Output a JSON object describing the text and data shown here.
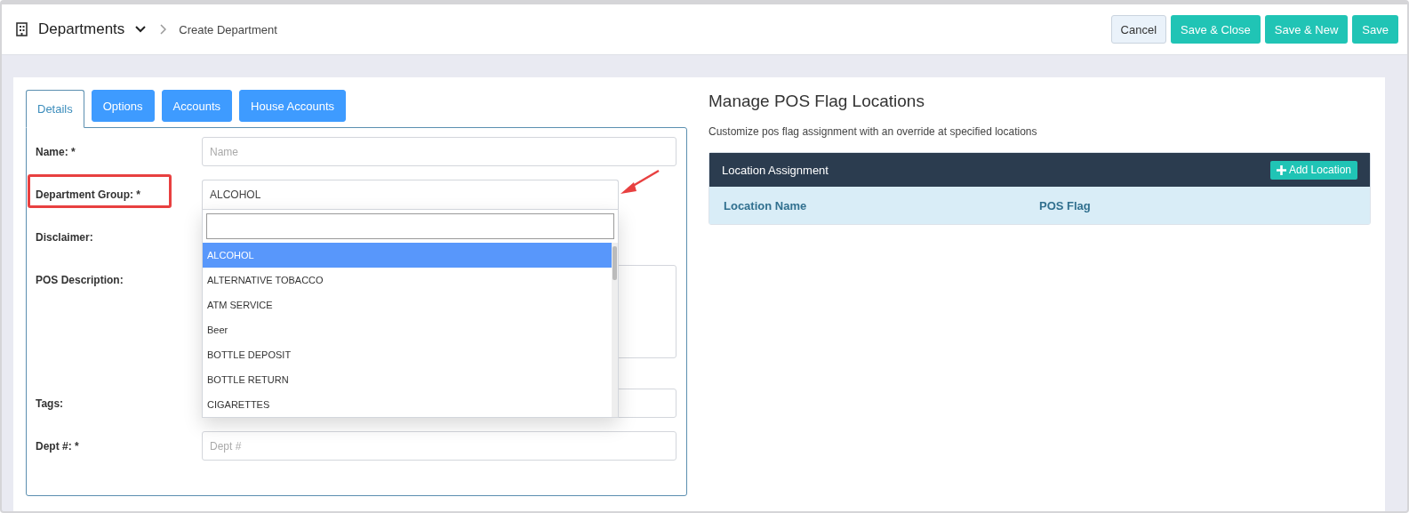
{
  "header": {
    "title": "Departments",
    "breadcrumb": "Create Department",
    "buttons": [
      {
        "label": "Cancel",
        "kind": "secondary"
      },
      {
        "label": "Save & Close",
        "kind": "primary"
      },
      {
        "label": "Save & New",
        "kind": "primary"
      },
      {
        "label": "Save",
        "kind": "primary"
      }
    ]
  },
  "tabs": [
    {
      "label": "Details",
      "selected": true
    },
    {
      "label": "Options",
      "selected": false
    },
    {
      "label": "Accounts",
      "selected": false
    },
    {
      "label": "House Accounts",
      "selected": false
    }
  ],
  "form": {
    "fields": [
      {
        "label": "Name: *",
        "kind": "input",
        "placeholder": "Name"
      },
      {
        "label": "Department Group: *",
        "kind": "select",
        "value": "ALCOHOL",
        "highlighted": true,
        "expanded": true
      },
      {
        "label": "Disclaimer:",
        "kind": "hidden"
      },
      {
        "label": "POS Description:",
        "kind": "textarea"
      },
      {
        "label": "Tags:",
        "kind": "input"
      },
      {
        "label": "Dept #: *",
        "kind": "input",
        "placeholder": "Dept #"
      }
    ]
  },
  "dropdown": {
    "options": [
      {
        "label": "ALCOHOL",
        "selected": true
      },
      {
        "label": "ALTERNATIVE TOBACCO",
        "selected": false
      },
      {
        "label": "ATM SERVICE",
        "selected": false
      },
      {
        "label": "Beer",
        "selected": false
      },
      {
        "label": "BOTTLE DEPOSIT",
        "selected": false
      },
      {
        "label": "BOTTLE RETURN",
        "selected": false
      },
      {
        "label": "CIGARETTES",
        "selected": false
      }
    ]
  },
  "locations": {
    "title": "Manage POS Flag Locations",
    "subtitle": "Customize pos flag assignment with an override at specified locations",
    "panel_title": "Location Assignment",
    "add_button": "Add Location",
    "columns": [
      "Location Name",
      "POS Flag"
    ]
  }
}
